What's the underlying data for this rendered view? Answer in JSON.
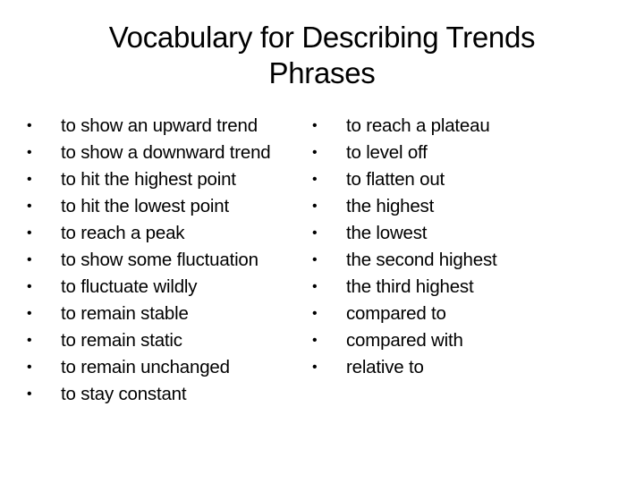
{
  "title": {
    "line1": "Vocabulary for Describing Trends",
    "line2": "Phrases"
  },
  "bullet_icon": "bullet-dot-icon",
  "left_list": [
    "to show an upward trend",
    "to show a downward trend",
    "to hit the highest point",
    "to hit the lowest point",
    "to reach a peak",
    "to show some fluctuation",
    "to fluctuate wildly",
    "to remain stable",
    "to remain static",
    "to remain unchanged",
    "to stay constant"
  ],
  "right_list": [
    "to reach a plateau",
    "to level off",
    "to flatten out",
    "the highest",
    "the lowest",
    "the second highest",
    "the third highest",
    "compared to",
    "compared with",
    "relative to"
  ]
}
